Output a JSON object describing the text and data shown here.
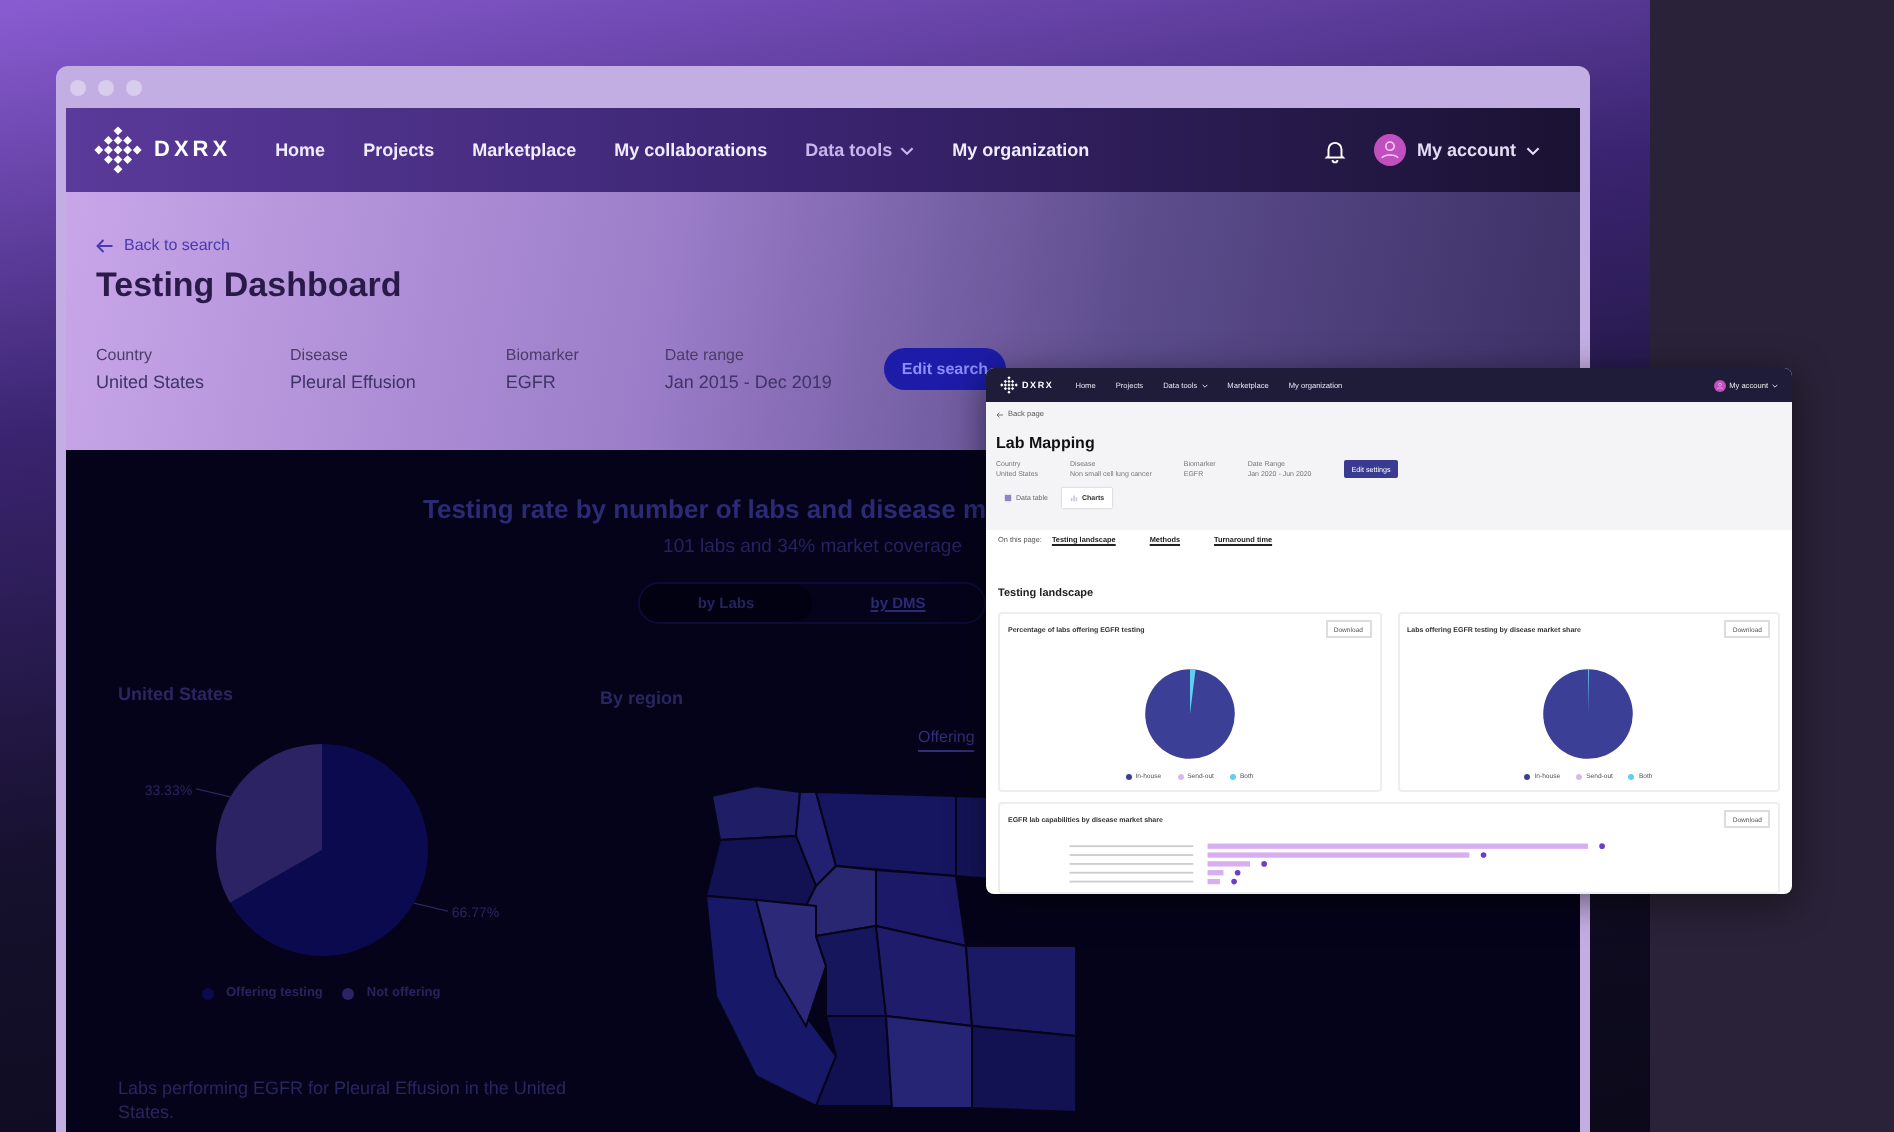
{
  "main_window": {
    "nav": {
      "logo": "DXRX",
      "items": [
        {
          "label": "Home",
          "kind": "link"
        },
        {
          "label": "Projects",
          "kind": "link"
        },
        {
          "label": "Marketplace",
          "kind": "link"
        },
        {
          "label": "My collaborations",
          "kind": "link"
        },
        {
          "label": "Data tools",
          "kind": "dropdown"
        },
        {
          "label": "My organization",
          "kind": "link"
        }
      ],
      "account": "My account"
    },
    "back_link": "Back to search",
    "title": "Testing Dashboard",
    "filters": [
      {
        "label": "Country",
        "value": "United States"
      },
      {
        "label": "Disease",
        "value": "Pleural Effusion"
      },
      {
        "label": "Biomarker",
        "value": "EGFR"
      },
      {
        "label": "Date range",
        "value": "Jan 2015 - Dec 2019"
      }
    ],
    "edit_button": "Edit search",
    "section": {
      "title": "Testing rate by number of labs and disease m",
      "subtitle": "101 labs and 34% market coverage",
      "toggle": [
        {
          "label": "by Labs",
          "selected": true
        },
        {
          "label": "by DMS",
          "selected": false
        }
      ]
    },
    "country_panel": {
      "title": "United States",
      "chart_data": {
        "type": "pie",
        "categories": [
          "Offering testing",
          "Not offering"
        ],
        "values": [
          66.77,
          33.33
        ],
        "value_labels": [
          "66.77%",
          "33.33%"
        ]
      },
      "legend": [
        {
          "color": "#0c0a4e"
        },
        {
          "color": "#2b2364"
        }
      ]
    },
    "region_panel": {
      "title": "By region",
      "tabs": [
        {
          "label": "Offering",
          "selected": true
        }
      ]
    },
    "description": "Labs performing EGFR for Pleural Effusion in the United States."
  },
  "overlay_window": {
    "nav": {
      "logo": "DXRX",
      "items": [
        {
          "label": "Home",
          "kind": "link"
        },
        {
          "label": "Projects",
          "kind": "link"
        },
        {
          "label": "Data tools",
          "kind": "dropdown"
        },
        {
          "label": "Marketplace",
          "kind": "link"
        },
        {
          "label": "My organization",
          "kind": "link"
        }
      ],
      "account": "My account"
    },
    "back_link": "Back page",
    "title": "Lab Mapping",
    "filters": [
      {
        "label": "Country",
        "value": "United States"
      },
      {
        "label": "Disease",
        "value": "Non small cell lung cancer"
      },
      {
        "label": "Biomarker",
        "value": "EGFR"
      },
      {
        "label": "Date Range",
        "value": "Jan 2020 - Jun 2020"
      }
    ],
    "edit_button": "Edit settings",
    "view_tabs": [
      {
        "label": "Data table",
        "selected": false
      },
      {
        "label": "Charts",
        "selected": true
      }
    ],
    "on_this_page": {
      "label": "On this page:",
      "links": [
        "Testing landscape",
        "Methods",
        "Turnaround time"
      ]
    },
    "heading": "Testing landscape",
    "cards": [
      {
        "title": "Percentage of labs offering EGFR testing",
        "button": "Download",
        "legend": [
          "In-house",
          "Send-out",
          "Both"
        ]
      },
      {
        "title": "Labs offering EGFR testing by disease market share",
        "button": "Download",
        "legend": [
          "In-house",
          "Send-out",
          "Both"
        ]
      }
    ],
    "bar_card": {
      "title": "EGFR lab capabilities by disease market share",
      "button": "Download"
    }
  }
}
